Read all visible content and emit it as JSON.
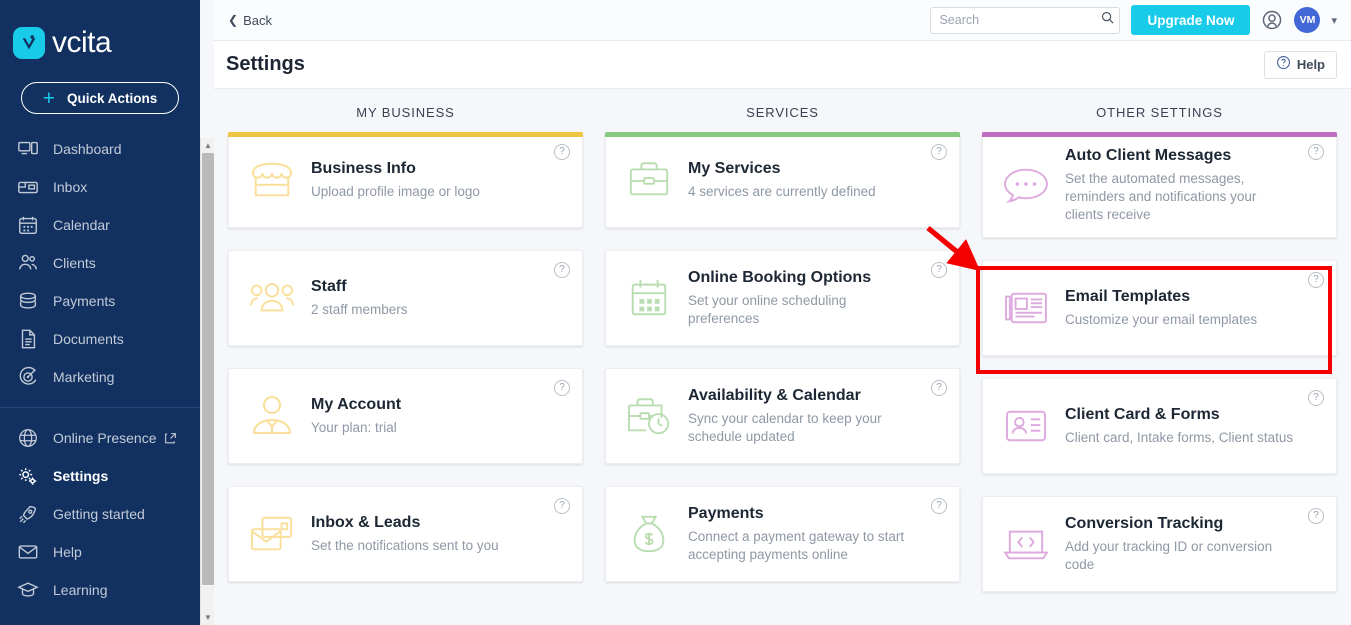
{
  "sidebar": {
    "logo_text": "vcita",
    "quick_actions_label": "Quick Actions",
    "items": [
      {
        "label": "Dashboard",
        "icon": "dashboard-icon",
        "active": false
      },
      {
        "label": "Inbox",
        "icon": "inbox-icon",
        "active": false
      },
      {
        "label": "Calendar",
        "icon": "calendar-icon",
        "active": false
      },
      {
        "label": "Clients",
        "icon": "clients-icon",
        "active": false
      },
      {
        "label": "Payments",
        "icon": "payments-icon",
        "active": false
      },
      {
        "label": "Documents",
        "icon": "documents-icon",
        "active": false
      },
      {
        "label": "Marketing",
        "icon": "marketing-icon",
        "active": false
      }
    ],
    "items_bottom": [
      {
        "label": "Online Presence",
        "icon": "globe-icon",
        "active": false,
        "external": true
      },
      {
        "label": "Settings",
        "icon": "gear-icon",
        "active": true,
        "external": false
      },
      {
        "label": "Getting started",
        "icon": "rocket-icon",
        "active": false,
        "external": false
      },
      {
        "label": "Help",
        "icon": "envelope-icon",
        "active": false,
        "external": false
      },
      {
        "label": "Learning",
        "icon": "graduation-cap-icon",
        "active": false,
        "external": false
      }
    ]
  },
  "topbar": {
    "back_label": "Back",
    "search_placeholder": "Search",
    "search_value": "",
    "upgrade_label": "Upgrade Now",
    "avatar_initials": "VM"
  },
  "subheader": {
    "page_title": "Settings",
    "help_label": "Help"
  },
  "colors": {
    "accent_yellow": "#efc443",
    "accent_green": "#88c880",
    "accent_purple": "#be6dbe",
    "brand_cyan": "#18cbe8",
    "sidebar_navy": "#123160",
    "highlight_red": "#f50000"
  },
  "columns": [
    {
      "title": "MY BUSINESS",
      "accent": "yellow",
      "cards": [
        {
          "title": "Business Info",
          "subtitle": "Upload profile image or logo",
          "icon": "storefront-icon",
          "help": "?"
        },
        {
          "title": "Staff",
          "subtitle": "2 staff members",
          "icon": "people-group-icon",
          "help": "?"
        },
        {
          "title": "My Account",
          "subtitle": "Your plan: trial",
          "icon": "person-tie-icon",
          "help": "?"
        },
        {
          "title": "Inbox & Leads",
          "subtitle": "Set the notifications sent to you",
          "icon": "envelope-cards-icon",
          "help": "?"
        }
      ]
    },
    {
      "title": "SERVICES",
      "accent": "green",
      "cards": [
        {
          "title": "My Services",
          "subtitle": "4 services are currently defined",
          "icon": "briefcase-icon",
          "help": "?"
        },
        {
          "title": "Online Booking Options",
          "subtitle": "Set your online scheduling preferences",
          "icon": "calendar-grid-icon",
          "help": "?"
        },
        {
          "title": "Availability & Calendar",
          "subtitle": "Sync your calendar to keep your schedule updated",
          "icon": "briefcase-clock-icon",
          "help": "?"
        },
        {
          "title": "Payments",
          "subtitle": "Connect a payment gateway to start accepting payments online",
          "icon": "money-bag-icon",
          "help": "?"
        }
      ]
    },
    {
      "title": "OTHER SETTINGS",
      "accent": "purple",
      "cards": [
        {
          "title": "Auto Client Messages",
          "subtitle": "Set the automated messages, reminders and notifications your clients receive",
          "icon": "chat-bubble-icon",
          "help": "?"
        },
        {
          "title": "Email Templates",
          "subtitle": "Customize your email templates",
          "icon": "newspaper-icon",
          "help": "?",
          "highlighted": true
        },
        {
          "title": "Client Card & Forms",
          "subtitle": "Client card, Intake forms, Client status",
          "icon": "id-card-icon",
          "help": "?"
        },
        {
          "title": "Conversion Tracking",
          "subtitle": "Add your tracking ID or conversion code",
          "icon": "laptop-code-icon",
          "help": "?"
        }
      ]
    }
  ]
}
